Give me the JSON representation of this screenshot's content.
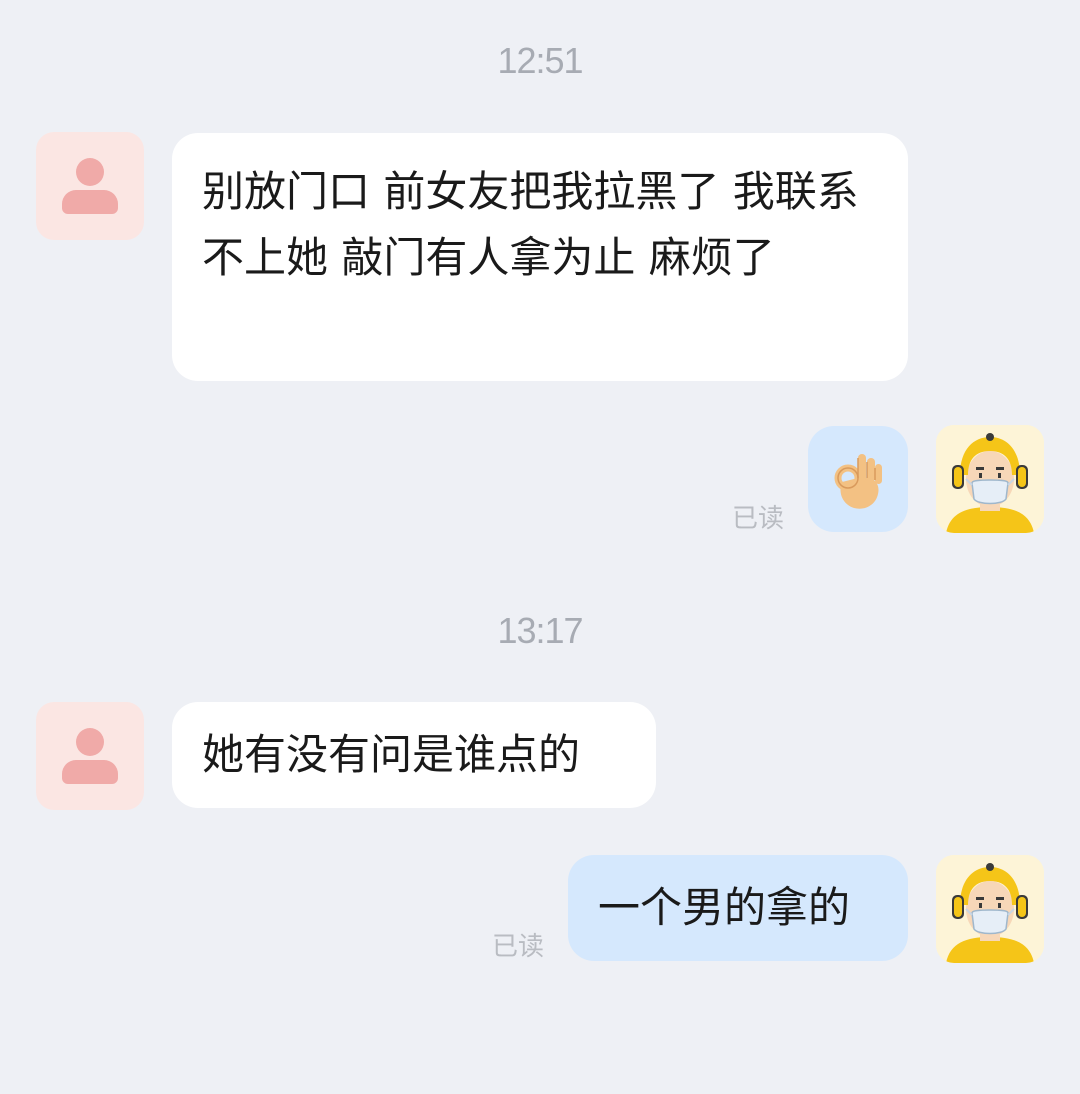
{
  "conversation": {
    "messages": [
      {
        "timestamp": "12:51"
      },
      {
        "sender": "contact",
        "text": "别放门口  前女友把我拉黑了  我联系不上她  敲门有人拿为止  麻烦了"
      },
      {
        "sender": "me",
        "emoji": "ok-hand-emoji",
        "read_status": "已读"
      },
      {
        "timestamp": "13:17"
      },
      {
        "sender": "contact",
        "text": "她有没有问是谁点的"
      },
      {
        "sender": "me",
        "text": "一个男的拿的",
        "read_status": "已读"
      }
    ]
  },
  "icons": {
    "contact_avatar": "person-silhouette-icon",
    "my_avatar": "courier-helmet-mask-avatar",
    "emoji": "ok-hand-emoji"
  },
  "colors": {
    "background": "#eef0f5",
    "incoming_bubble": "#ffffff",
    "outgoing_bubble": "#d5e8fd",
    "timestamp_text": "#a7abb3",
    "read_text": "#b9bcc2",
    "contact_avatar_bg": "#fbe6e3",
    "contact_avatar_fg": "#f0aaa8",
    "courier_yellow": "#f5c518"
  }
}
